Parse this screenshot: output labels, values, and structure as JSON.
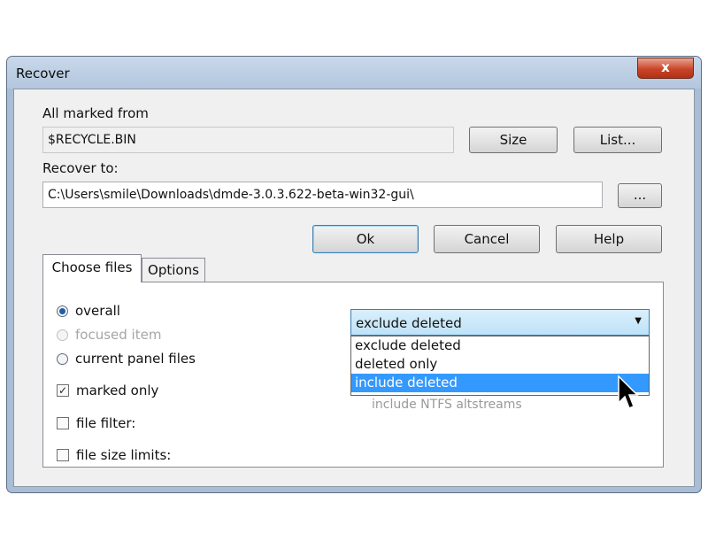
{
  "window": {
    "title": "Recover",
    "close_label": "x"
  },
  "form": {
    "marked_from_label": "All marked from",
    "marked_from_value": "$RECYCLE.BIN",
    "recover_to_label": "Recover to:",
    "recover_to_value": "C:\\Users\\smile\\Downloads\\dmde-3.0.3.622-beta-win32-gui\\",
    "size_button": "Size",
    "list_button": "List...",
    "browse_button": "...",
    "ok_button": "Ok",
    "cancel_button": "Cancel",
    "help_button": "Help"
  },
  "tabs": [
    {
      "label": "Choose files",
      "active": true
    },
    {
      "label": "Options",
      "active": false
    }
  ],
  "choose_files": {
    "radios": [
      {
        "label": "overall",
        "checked": true,
        "enabled": true
      },
      {
        "label": "focused item",
        "checked": false,
        "enabled": false
      },
      {
        "label": "current panel files",
        "checked": false,
        "enabled": true
      }
    ],
    "checkboxes": [
      {
        "label": "marked only",
        "checked": true,
        "mark": "✓"
      },
      {
        "label": "file filter:",
        "checked": false,
        "mark": ""
      },
      {
        "label": "file size limits:",
        "checked": false,
        "mark": ""
      }
    ],
    "deleted_select": {
      "value": "exclude deleted",
      "options": [
        "exclude deleted",
        "deleted only",
        "include deleted"
      ],
      "highlighted": "include deleted"
    },
    "partially_hidden_text": "include NTFS altstreams"
  }
}
